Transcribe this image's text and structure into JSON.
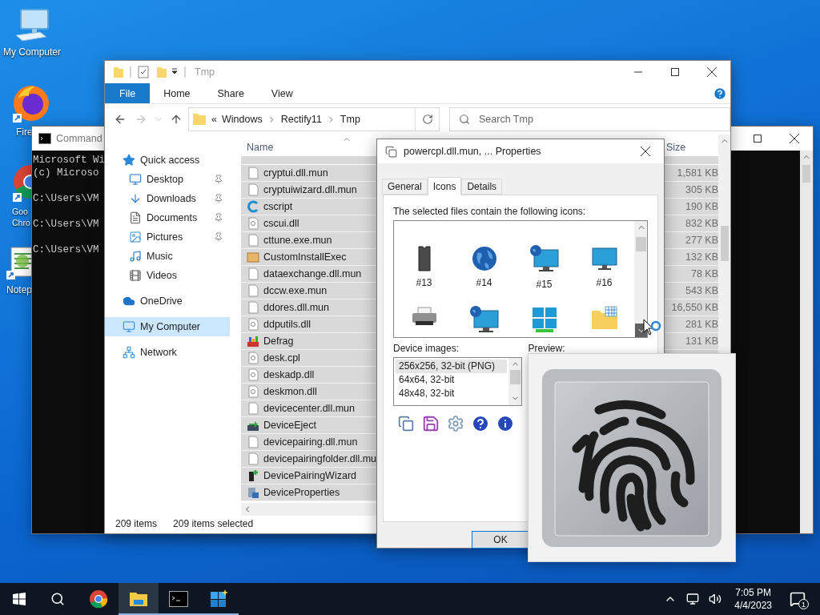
{
  "desktop_icons": [
    {
      "label": "My Computer",
      "kind": "computer"
    },
    {
      "label": "Fire",
      "kind": "firefox"
    },
    {
      "label": "Goo Chro",
      "kind": "chrome"
    },
    {
      "label": "Notep",
      "kind": "notepad"
    }
  ],
  "command_window": {
    "title": "Command",
    "blocks": [
      [
        "Microsoft Wi",
        "(c) Microso"
      ],
      [
        "C:\\Users\\VM"
      ],
      [
        "C:\\Users\\VM"
      ],
      [
        "C:\\Users\\VM"
      ]
    ]
  },
  "explorer": {
    "title": "Tmp",
    "ribbon_tabs": [
      {
        "label": "File",
        "kind": "file"
      },
      {
        "label": "Home",
        "kind": "tab"
      },
      {
        "label": "Share",
        "kind": "tab"
      },
      {
        "label": "View",
        "kind": "tab"
      }
    ],
    "address": {
      "overflow": "«",
      "crumbs": [
        "Windows",
        "Rectify11",
        "Tmp"
      ]
    },
    "search": {
      "placeholder": "Search Tmp"
    },
    "nav": [
      {
        "label": "Quick access",
        "kind": "star",
        "selected": false,
        "children": [
          {
            "label": "Desktop",
            "kind": "desktop",
            "pinned": true,
            "selected": false
          },
          {
            "label": "Downloads",
            "kind": "downloads",
            "pinned": true,
            "selected": false
          },
          {
            "label": "Documents",
            "kind": "documents",
            "pinned": true,
            "selected": false
          },
          {
            "label": "Pictures",
            "kind": "pictures",
            "pinned": true,
            "selected": false
          },
          {
            "label": "Music",
            "kind": "music",
            "pinned": false,
            "selected": false
          },
          {
            "label": "Videos",
            "kind": "videos",
            "pinned": false,
            "selected": false
          }
        ]
      },
      {
        "label": "OneDrive",
        "kind": "cloud",
        "selected": false
      },
      {
        "label": "My Computer",
        "kind": "computer",
        "selected": true
      },
      {
        "label": "Network",
        "kind": "network",
        "selected": false
      }
    ],
    "columns": [
      "Name",
      "Size"
    ],
    "rows": [
      {
        "name": "cryptui.dll.mun",
        "size": "1,581 KB",
        "kind": "file",
        "selected": true
      },
      {
        "name": "cryptuiwizard.dll.mun",
        "size": "305 KB",
        "kind": "file",
        "selected": true
      },
      {
        "name": "cscript",
        "size": "190 KB",
        "kind": "script",
        "selected": true
      },
      {
        "name": "cscui.dll",
        "size": "832 KB",
        "kind": "dll",
        "selected": true
      },
      {
        "name": "cttune.exe.mun",
        "size": "277 KB",
        "kind": "file",
        "selected": true
      },
      {
        "name": "CustomInstallExec",
        "size": "132 KB",
        "kind": "installer",
        "selected": true
      },
      {
        "name": "dataexchange.dll.mun",
        "size": "78 KB",
        "kind": "file",
        "selected": true
      },
      {
        "name": "dccw.exe.mun",
        "size": "543 KB",
        "kind": "file",
        "selected": true
      },
      {
        "name": "ddores.dll.mun",
        "size": "16,550 KB",
        "kind": "file",
        "selected": true
      },
      {
        "name": "ddputils.dll",
        "size": "281 KB",
        "kind": "dll",
        "selected": true
      },
      {
        "name": "Defrag",
        "size": "131 KB",
        "kind": "defrag",
        "selected": true
      },
      {
        "name": "desk.cpl",
        "kind": "dll",
        "selected": true
      },
      {
        "name": "deskadp.dll",
        "kind": "dll",
        "selected": true
      },
      {
        "name": "deskmon.dll",
        "kind": "dll",
        "selected": true
      },
      {
        "name": "devicecenter.dll.mun",
        "kind": "file",
        "selected": true
      },
      {
        "name": "DeviceEject",
        "kind": "eject",
        "selected": true
      },
      {
        "name": "devicepairing.dll.mun",
        "kind": "file",
        "selected": true
      },
      {
        "name": "devicepairingfolder.dll.mu",
        "kind": "file",
        "selected": true
      },
      {
        "name": "DevicePairingWizard",
        "kind": "wizard",
        "selected": true
      },
      {
        "name": "DeviceProperties",
        "kind": "properties",
        "selected": true
      }
    ],
    "status": [
      "209 items",
      "209 items selected"
    ]
  },
  "dialog": {
    "title": "powercpl.dll.mun, ... Properties",
    "tabs": [
      {
        "label": "General",
        "selected": false
      },
      {
        "label": "Icons",
        "selected": true
      },
      {
        "label": "Details",
        "selected": false
      }
    ],
    "icons_label": "The selected files contain the following icons:",
    "icons": [
      {
        "label": "#13",
        "kind": "chip"
      },
      {
        "label": "#14",
        "kind": "globe"
      },
      {
        "label": "#15",
        "kind": "monitor-globe"
      },
      {
        "label": "#16",
        "kind": "monitor"
      },
      {
        "kind": "printer"
      },
      {
        "kind": "monitor-globe"
      },
      {
        "kind": "tiles"
      },
      {
        "kind": "folder"
      }
    ],
    "device_images": {
      "label": "Device images:",
      "items": [
        {
          "label": "256x256, 32-bit (PNG)",
          "selected": true
        },
        {
          "label": "64x64, 32-bit",
          "selected": false
        },
        {
          "label": "48x48, 32-bit",
          "selected": false
        }
      ]
    },
    "tools": [
      {
        "kind": "copy"
      },
      {
        "kind": "save"
      },
      {
        "kind": "settings"
      },
      {
        "kind": "help"
      },
      {
        "kind": "info"
      }
    ],
    "preview_label": "Preview:",
    "ok": "OK"
  },
  "taskbar": {
    "apps": [
      {
        "kind": "chrome",
        "running": false,
        "selected": false
      },
      {
        "kind": "explorer",
        "running": true,
        "selected": true
      },
      {
        "kind": "terminal",
        "running": true,
        "selected": false
      },
      {
        "kind": "tiles",
        "running": true,
        "selected": false
      }
    ],
    "time": "7:05 PM",
    "date": "4/4/2023",
    "notifications": "1"
  }
}
